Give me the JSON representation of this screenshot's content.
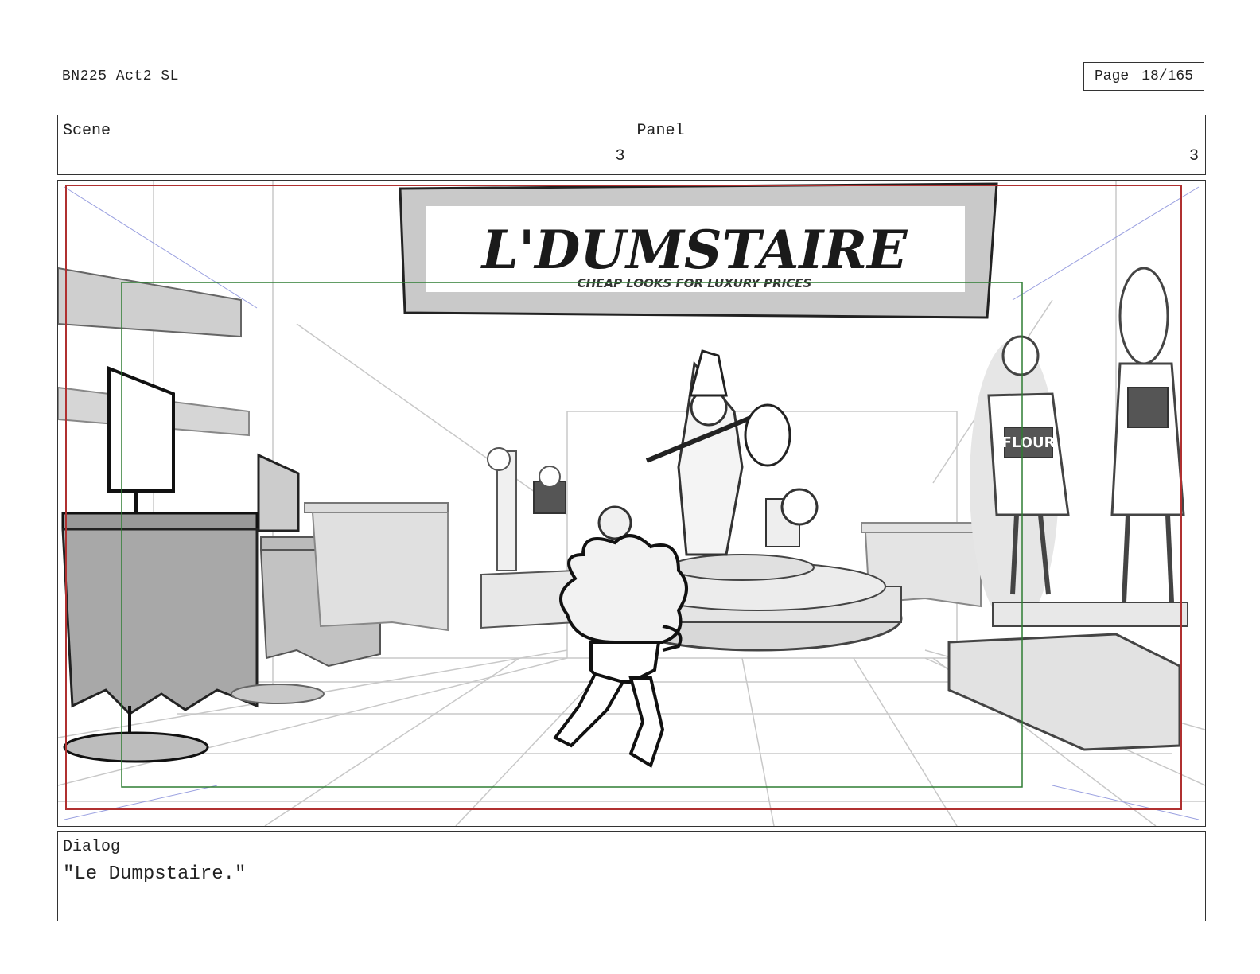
{
  "header": {
    "doc_title": "BN225 Act2 SL",
    "page_label": "Page",
    "page_number": "18/165"
  },
  "scene": {
    "label": "Scene",
    "value": "3"
  },
  "panel": {
    "label": "Panel",
    "value": "3"
  },
  "artwork": {
    "sign_title": "L'DUMSTAIRE",
    "sign_tagline": "CHEAP LOOKS FOR LUXURY PRICES",
    "shirt_text": "FLOUR",
    "safe_frame_color": "#b03030",
    "action_frame_color": "#2e7d32"
  },
  "dialog": {
    "label": "Dialog",
    "text": "\"Le Dumpstaire.\""
  }
}
